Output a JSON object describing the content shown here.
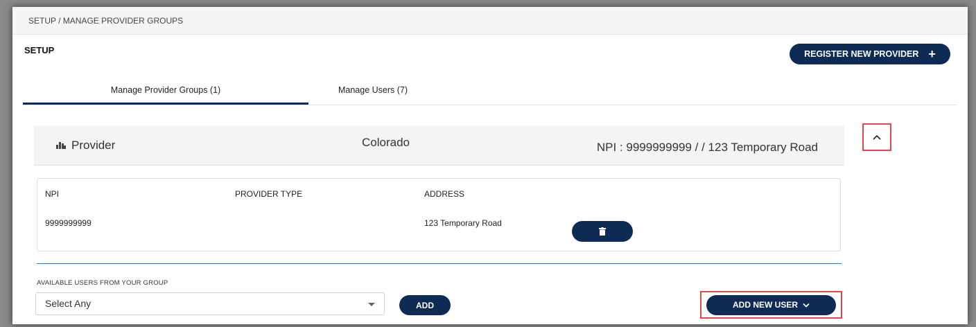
{
  "breadcrumb": "SETUP / MANAGE PROVIDER GROUPS",
  "page_title": "SETUP",
  "register_button": "REGISTER NEW PROVIDER",
  "tabs": [
    {
      "label": "Manage Provider Groups (1)",
      "active": true
    },
    {
      "label": "Manage Users (7)",
      "active": false
    }
  ],
  "provider": {
    "name": "Provider",
    "state": "Colorado",
    "npi_summary": "NPI : 9999999999 / / 123 Temporary Road"
  },
  "table": {
    "columns": [
      "NPI",
      "PROVIDER TYPE",
      "ADDRESS"
    ],
    "rows": [
      {
        "npi": "9999999999",
        "provider_type": "",
        "address": "123 Temporary Road"
      }
    ]
  },
  "available_users": {
    "label": "AVAILABLE USERS FROM YOUR GROUP",
    "selected": "Select Any",
    "add_label": "ADD"
  },
  "add_new_user_label": "ADD NEW USER",
  "colors": {
    "primary": "#0e2b55",
    "highlight": "#e0474c",
    "divider": "#2f6fb6"
  },
  "icons": {
    "collapse": "chevron-up-icon",
    "delete": "trash-icon",
    "provider": "building-icon",
    "register": "plus-icon",
    "add_user": "chevron-down-icon"
  }
}
